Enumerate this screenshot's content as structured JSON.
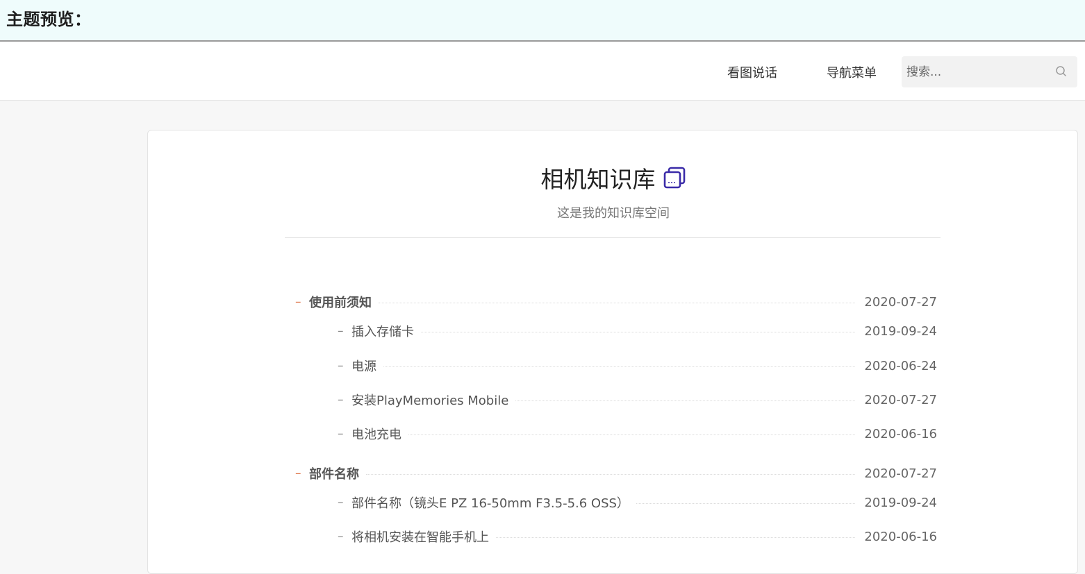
{
  "preview": {
    "title": "主题预览："
  },
  "nav": {
    "links": [
      "看图说话",
      "导航菜单"
    ],
    "search_placeholder": "搜索..."
  },
  "kb": {
    "title": "相机知识库",
    "subtitle": "这是我的知识库空间",
    "icon": "book-stack-icon"
  },
  "toc": [
    {
      "label": "使用前须知",
      "date": "2020-07-27",
      "level": 1
    },
    {
      "label": "插入存储卡",
      "date": "2019-09-24",
      "level": 2
    },
    {
      "label": "电源",
      "date": "2020-06-24",
      "level": 2
    },
    {
      "label": "安装PlayMemories Mobile",
      "date": "2020-07-27",
      "level": 2
    },
    {
      "label": "电池充电",
      "date": "2020-06-16",
      "level": 2
    },
    {
      "label": "部件名称",
      "date": "2020-07-27",
      "level": 1
    },
    {
      "label": "部件名称（镜头E PZ 16-50mm F3.5-5.6 OSS）",
      "date": "2019-09-24",
      "level": 2
    },
    {
      "label": "将相机安装在智能手机上",
      "date": "2020-06-16",
      "level": 2
    }
  ],
  "colors": {
    "accent": "#e07a4f",
    "preview_bg": "#effcfc",
    "icon": "#3a2ba8"
  }
}
